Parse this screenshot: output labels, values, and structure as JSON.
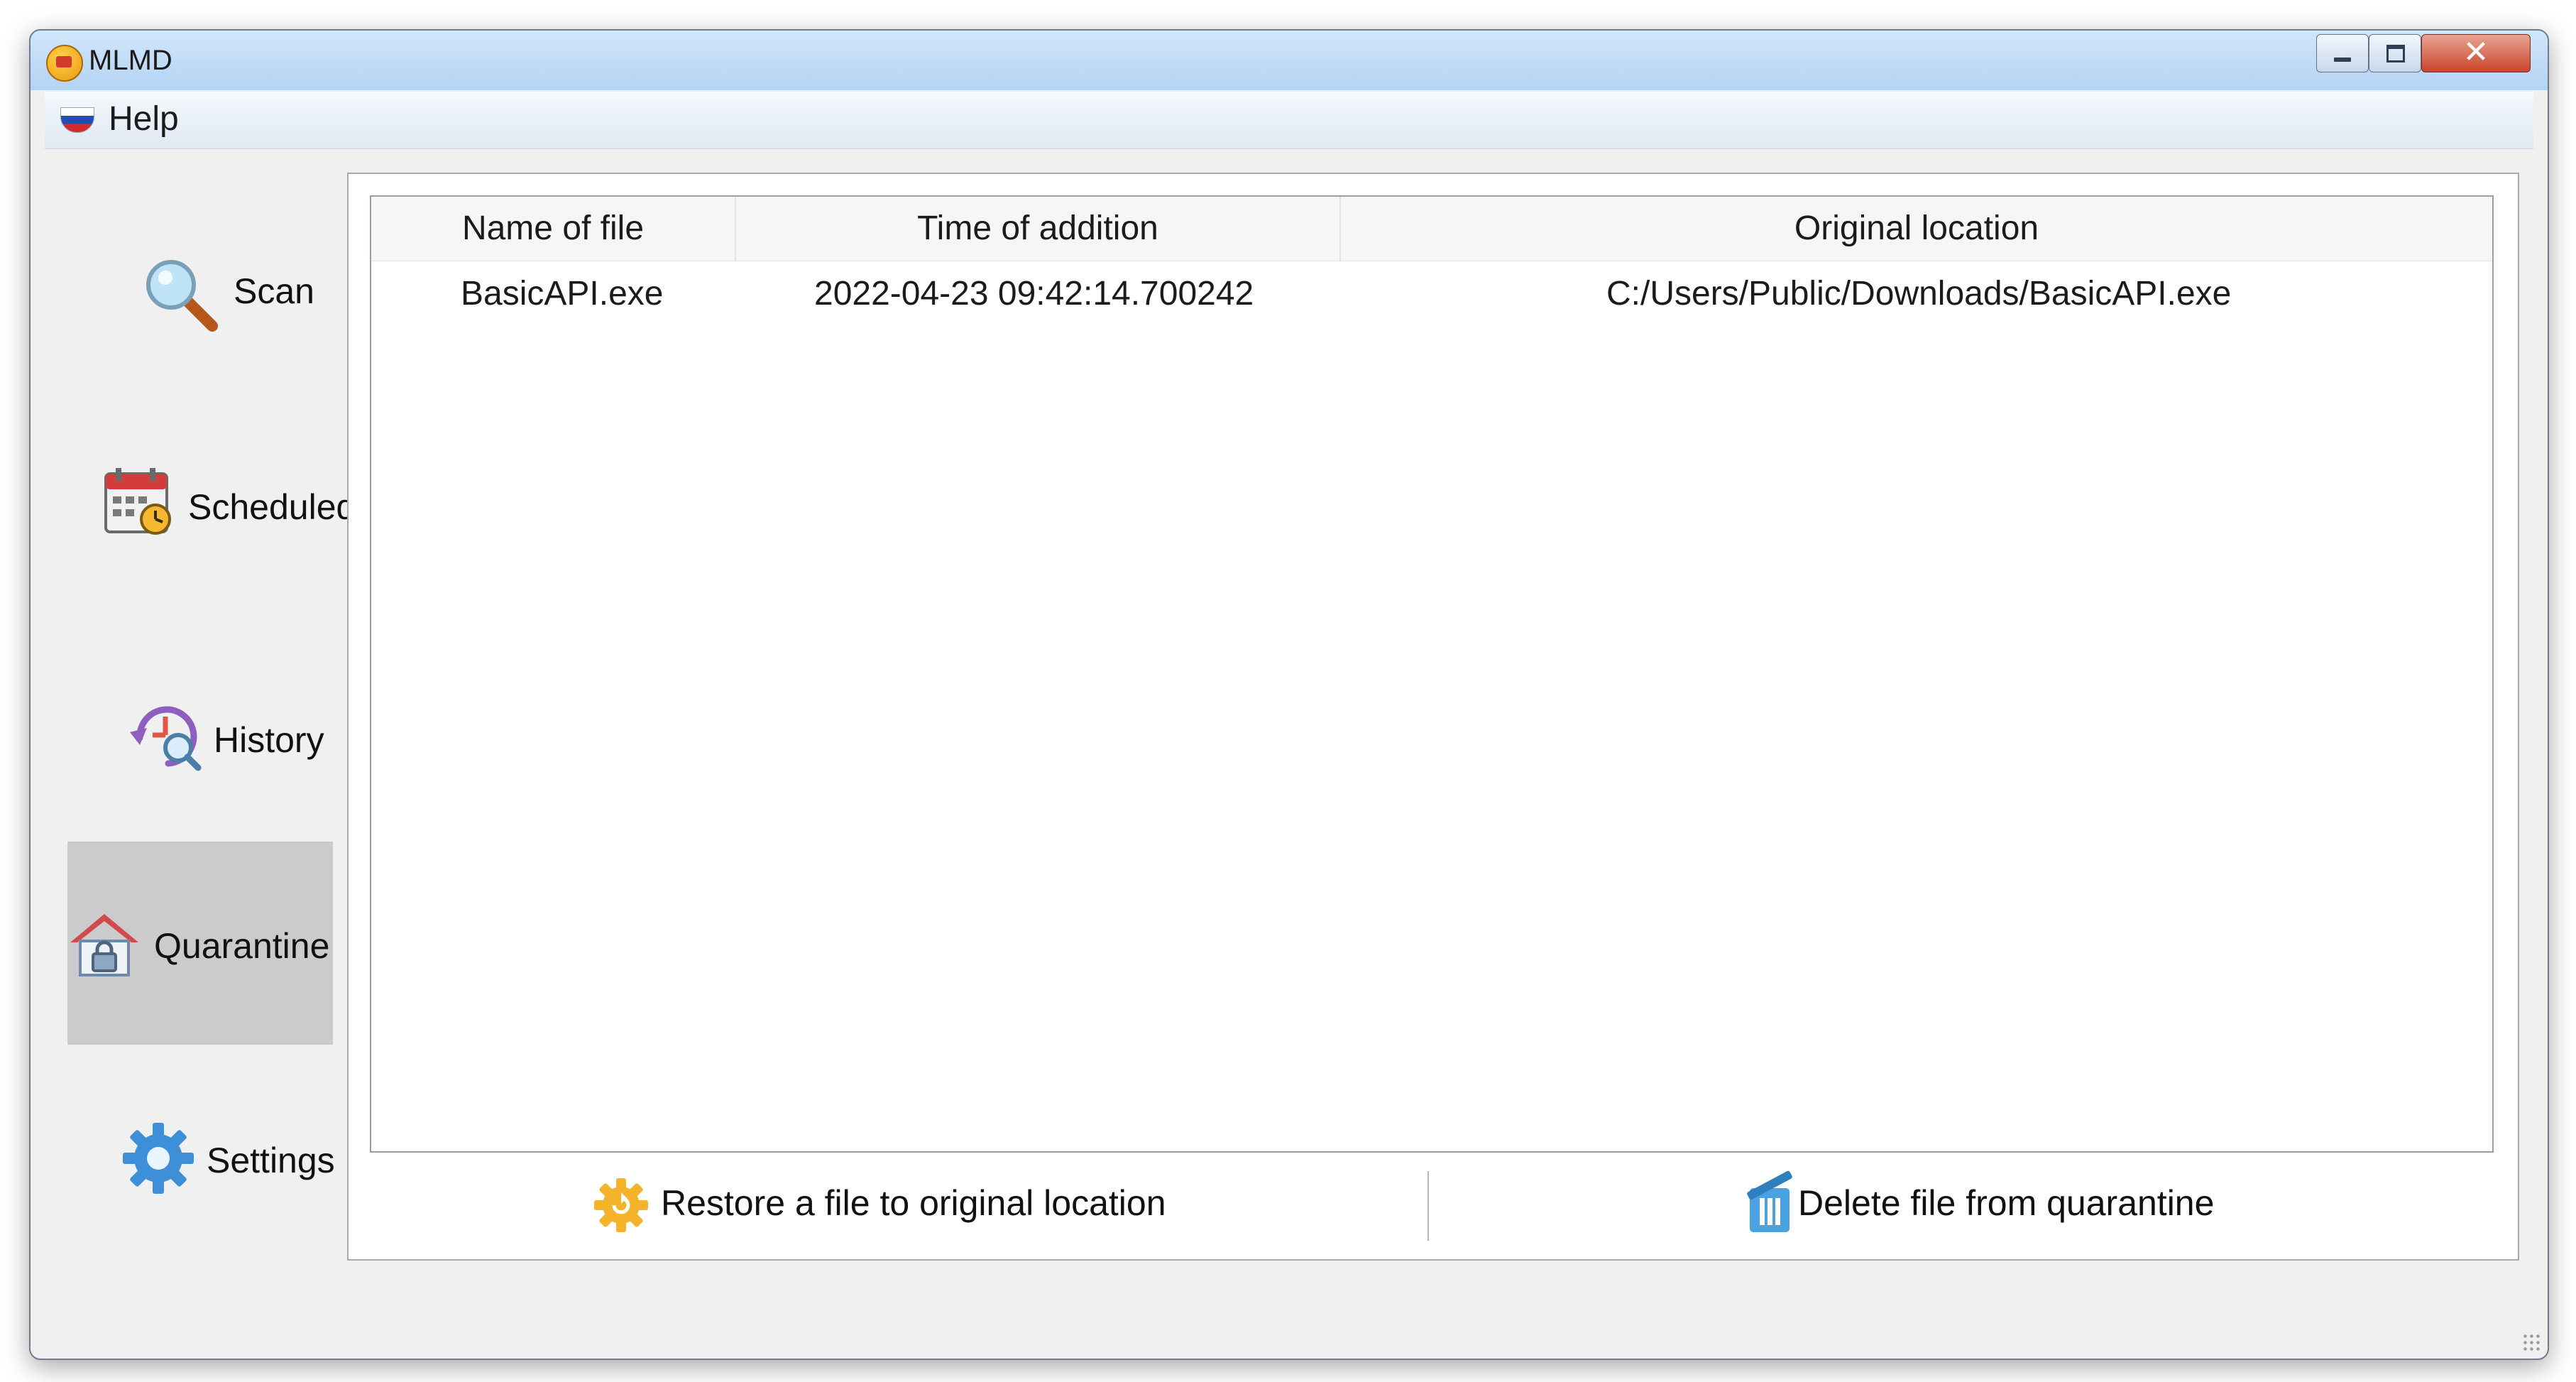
{
  "window": {
    "title": "MLMD"
  },
  "menu": {
    "help": "Help"
  },
  "sidebar": {
    "items": [
      {
        "label": "Scan",
        "icon": "magnifier-icon"
      },
      {
        "label": "Scheduled",
        "icon": "calendar-clock-icon"
      },
      {
        "label": "History",
        "icon": "history-icon"
      },
      {
        "label": "Quarantine",
        "icon": "house-lock-icon",
        "active": true
      },
      {
        "label": "Settings",
        "icon": "gear-icon"
      }
    ]
  },
  "table": {
    "columns": [
      "Name of file",
      "Time of addition",
      "Original location"
    ],
    "rows": [
      {
        "name": "BasicAPI.exe",
        "time": "2022-04-23 09:42:14.700242",
        "location": "C:/Users/Public/Downloads/BasicAPI.exe"
      }
    ]
  },
  "actions": {
    "restore": "Restore a file to original location",
    "delete": "Delete file from quarantine"
  },
  "colors": {
    "titlebar": "#b3d3f4",
    "active_sidebar": "#cbcbce",
    "close_button": "#c9452c"
  }
}
